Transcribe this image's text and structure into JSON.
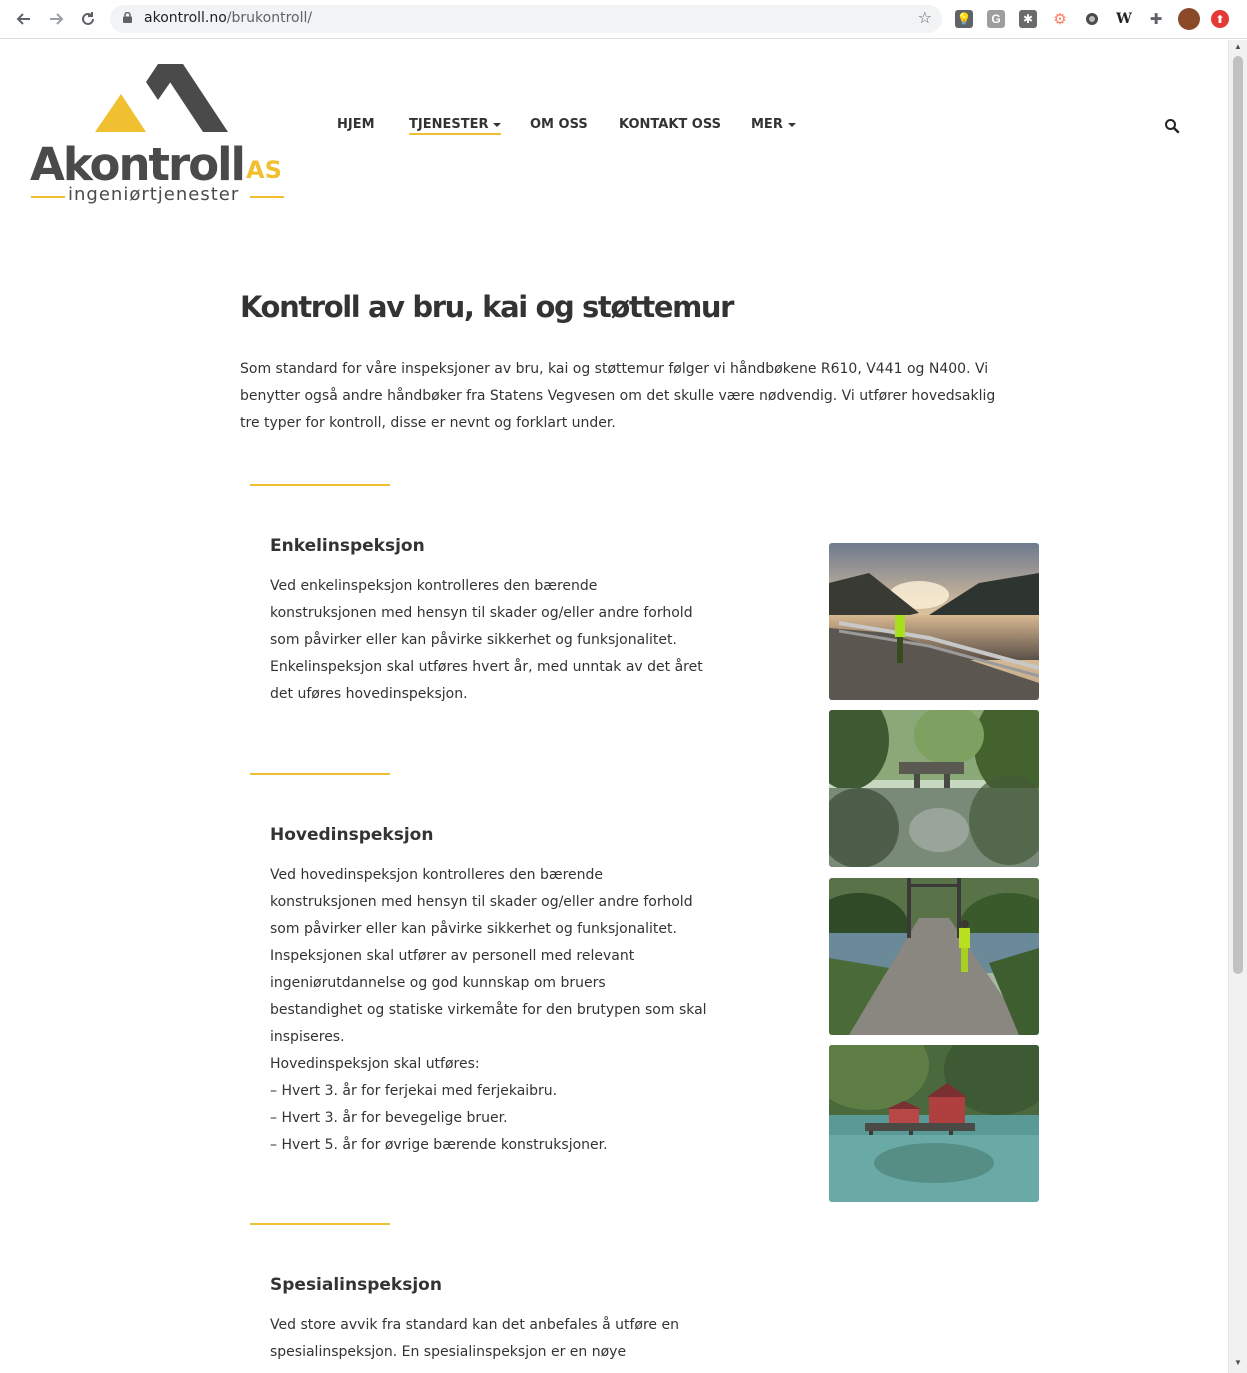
{
  "browser": {
    "url_host": "akontroll.no",
    "url_path": "/brukontroll/"
  },
  "logo": {
    "word": "Akontroll",
    "suffix": "AS",
    "tagline": "ingeniørtjenester"
  },
  "nav": {
    "items": [
      {
        "label": "HJEM"
      },
      {
        "label": "TJENESTER"
      },
      {
        "label": "OM OSS"
      },
      {
        "label": "KONTAKT OSS"
      },
      {
        "label": "MER"
      }
    ]
  },
  "colors": {
    "accent": "#f0c030",
    "text": "#333333"
  },
  "main": {
    "title": "Kontroll av bru, kai og støttemur",
    "intro": "Som standard for våre inspeksjoner av bru, kai og støttemur følger vi håndbøkene R610, V441 og N400. Vi benytter også andre håndbøker fra Statens Vegvesen om det skulle være nødvendig. Vi utfører hovedsaklig tre typer for kontroll, disse er nevnt og forklart under.",
    "sections": [
      {
        "heading": "Enkelinspeksjon",
        "lines": [
          "Ved enkelinspeksjon kontrolleres den bærende",
          "konstruksjonen med hensyn til skader og/eller andre forhold",
          "som påvirker eller kan påvirke sikkerhet og funksjonalitet.",
          "Enkelinspeksjon skal utføres hvert år, med unntak av det året",
          "det uføres hovedinspeksjon."
        ]
      },
      {
        "heading": "Hovedinspeksjon",
        "lines": [
          "Ved hovedinspeksjon kontrolleres den bærende",
          "konstruksjonen med hensyn til skader og/eller andre forhold",
          "som påvirker eller kan påvirke sikkerhet og funksjonalitet.",
          "Inspeksjonen skal utfører av personell med relevant",
          "ingeniørutdannelse og god kunnskap om bruers",
          "bestandighet og statiske virkemåte for den brutypen som skal",
          "inspiseres.",
          "Hovedinspeksjon skal utføres:",
          "– Hvert 3. år for ferjekai med ferjekaibru.",
          "– Hvert 3. år for bevegelige bruer.",
          "– Hvert 5. år for øvrige bærende konstruksjoner."
        ]
      },
      {
        "heading": "Spesialinspeksjon",
        "lines": [
          "Ved store avvik fra standard kan det anbefales å utføre en",
          "spesialinspeksjon. En spesialinspeksjon er en nøye"
        ]
      }
    ]
  }
}
